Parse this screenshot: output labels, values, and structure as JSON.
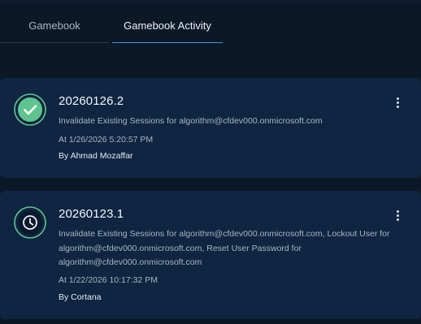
{
  "tabs": [
    {
      "label": "Gamebook",
      "active": false
    },
    {
      "label": "Gamebook Activity",
      "active": true
    }
  ],
  "colors": {
    "background": "#0b1828",
    "card": "#0f2541",
    "success": "#5fc58e",
    "accent": "#4e8fe0"
  },
  "activities": [
    {
      "status": "completed",
      "status_icon": "check-circle-icon",
      "version": "20260126.2",
      "description": "Invalidate Existing Sessions for algorithm@cfdev000.onmicrosoft.com",
      "time": "At 1/26/2026 5:20:57 PM",
      "by": "By Ahmad Mozaffar",
      "menu_icon": "more-vertical-icon"
    },
    {
      "status": "pending",
      "status_icon": "clock-icon",
      "version": "20260123.1",
      "description": "Invalidate Existing Sessions for algorithm@cfdev000.onmicrosoft.com, Lockout User for algorithm@cfdev000.onmicrosoft.com, Reset User Password for algorithm@cfdev000.onmicrosoft.com",
      "time": "At 1/22/2026 10:17:32 PM",
      "by": "By Cortana",
      "menu_icon": "more-vertical-icon"
    }
  ]
}
